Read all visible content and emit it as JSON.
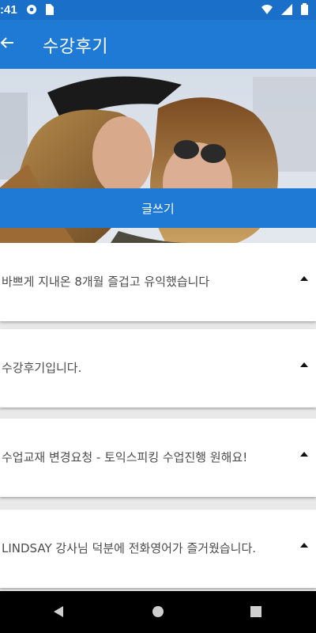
{
  "status_bar": {
    "time": ":41",
    "icons": [
      "settings-icon",
      "sim-card-icon",
      "wifi-icon",
      "signal-icon",
      "battery-icon"
    ]
  },
  "app_bar": {
    "title": "수강후기",
    "back_icon": "arrow-left-icon"
  },
  "hero": {
    "write_button_label": "글쓰기"
  },
  "reviews": [
    {
      "title": "바쁘게 지내온 8개월 즐겁고 유익했습니다"
    },
    {
      "title": "수강후기입니다."
    },
    {
      "title": "수업교재 변경요청 - 토익스피킹 수업진행 원해요!"
    },
    {
      "title": "LINDSAY 강사님 덕분에 전화영어가 즐거웠습니다."
    }
  ],
  "colors": {
    "primary": "#1f7ad6",
    "status_bar": "#1a70c9",
    "card_text": "#4b4b4b",
    "background": "#e9e9ea"
  },
  "nav_bar": {
    "icons": [
      "triangle-back-icon",
      "circle-home-icon",
      "square-recents-icon"
    ]
  }
}
